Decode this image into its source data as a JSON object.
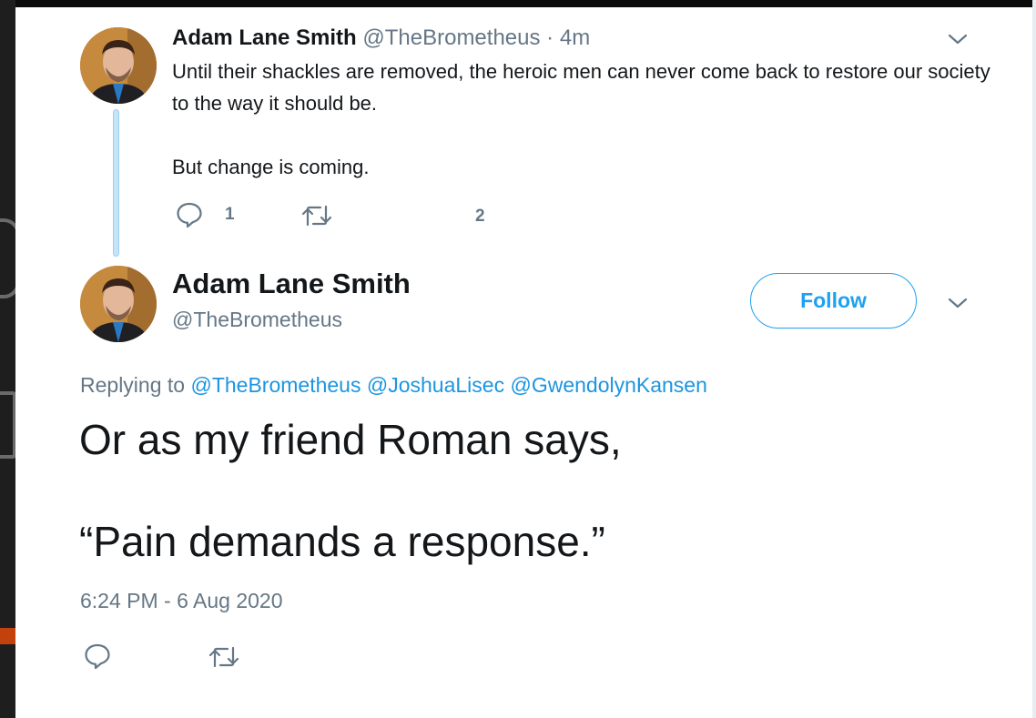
{
  "tweet1": {
    "name": "Adam Lane Smith",
    "handle": "@TheBrometheus",
    "dot": "·",
    "time": "4m",
    "body_p1": "Until their shackles are removed, the heroic men can never come back to restore our society to the way it should be.",
    "body_p2": "But change is coming.",
    "reply_count": "1",
    "like_count": "2",
    "icons": {
      "reply": "reply-icon",
      "retweet": "retweet-icon",
      "menu": "chevron-down-icon"
    }
  },
  "tweet2": {
    "name": "Adam Lane Smith",
    "handle": "@TheBrometheus",
    "follow_label": "Follow",
    "replying_prefix": "Replying to",
    "mentions": [
      "@TheBrometheus",
      "@JoshuaLisec",
      "@GwendolynKansen"
    ],
    "body_p1": "Or as my friend Roman says,",
    "body_p2": "“Pain demands a response.”",
    "timestamp": "6:24 PM - 6 Aug 2020",
    "icons": {
      "reply": "reply-icon",
      "retweet": "retweet-icon",
      "menu": "chevron-down-icon"
    }
  },
  "colors": {
    "accent": "#1da1f2",
    "mention": "#1b95e0",
    "secondary_text": "#657786",
    "primary_text": "#14171a",
    "thread_line": "#c4e4f8"
  }
}
